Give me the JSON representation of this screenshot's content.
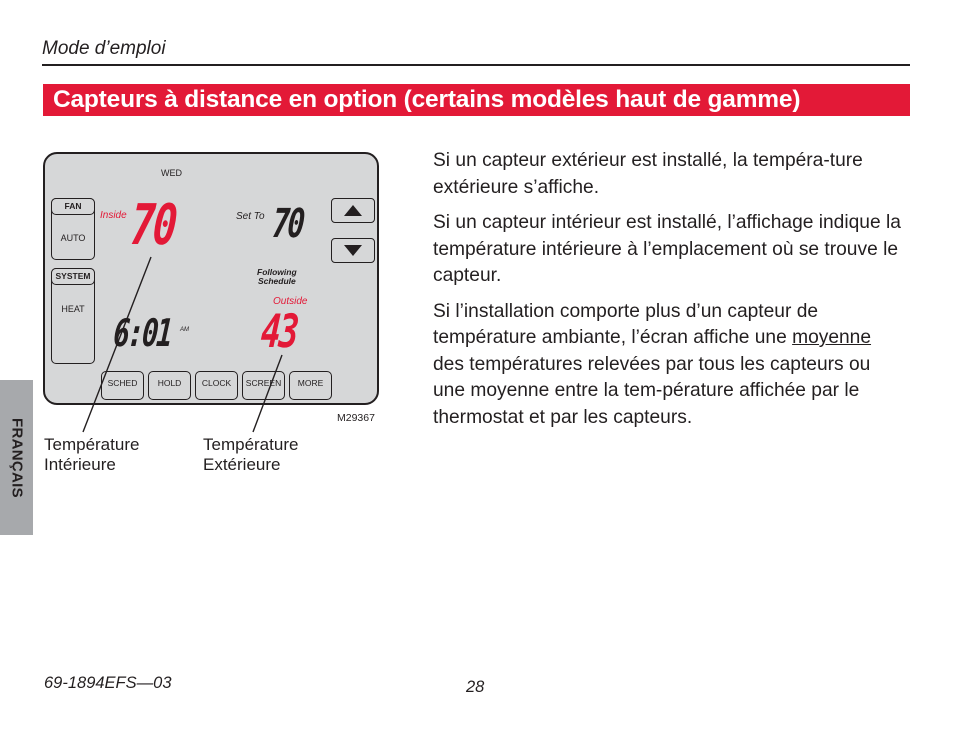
{
  "header": {
    "title": "Mode d’emploi"
  },
  "section": {
    "title": "Capteurs à distance en option (certains modèles haut de gamme)",
    "banner_color": "#e31937"
  },
  "side_tab": {
    "label": "FRANÇAIS"
  },
  "thermostat": {
    "day": "WED",
    "fan": {
      "label": "FAN",
      "value": "AUTO"
    },
    "system": {
      "label": "SYSTEM",
      "value": "HEAT"
    },
    "inside": {
      "label": "Inside",
      "value": "70"
    },
    "set_to": {
      "label": "Set To",
      "value": "70"
    },
    "schedule_status": {
      "line1": "Following",
      "line2": "Schedule"
    },
    "outside": {
      "label": "Outside",
      "value": "43"
    },
    "time": {
      "value": "6:01",
      "period": "AM"
    },
    "arrows": {
      "up": "up-arrow",
      "down": "down-arrow"
    },
    "softkeys": [
      "SCHED",
      "HOLD",
      "CLOCK",
      "SCREEN",
      "MORE"
    ],
    "display_red": "#e31937"
  },
  "figure": {
    "code": "M29367",
    "callouts": {
      "inside": {
        "line1": "Température",
        "line2": "Intérieure"
      },
      "outside": {
        "line1": "Température",
        "line2": "Extérieure"
      }
    }
  },
  "body": {
    "p1": "Si un capteur extérieur est installé, la tempéra-ture extérieure s’affiche.",
    "p2": "Si un capteur intérieur est installé, l’affichage indique la température intérieure à l’emplacement où se trouve le capteur.",
    "p3_before": "Si l’installation comporte plus d’un capteur de température ambiante, l’écran affiche une ",
    "p3_underlined": "moyenne",
    "p3_after": " des températures relevées par tous les capteurs ou une moyenne entre la tem-pérature affichée par le thermostat et par les capteurs."
  },
  "footer": {
    "doc_number": "69-1894EFS—03",
    "page_number": "28"
  }
}
